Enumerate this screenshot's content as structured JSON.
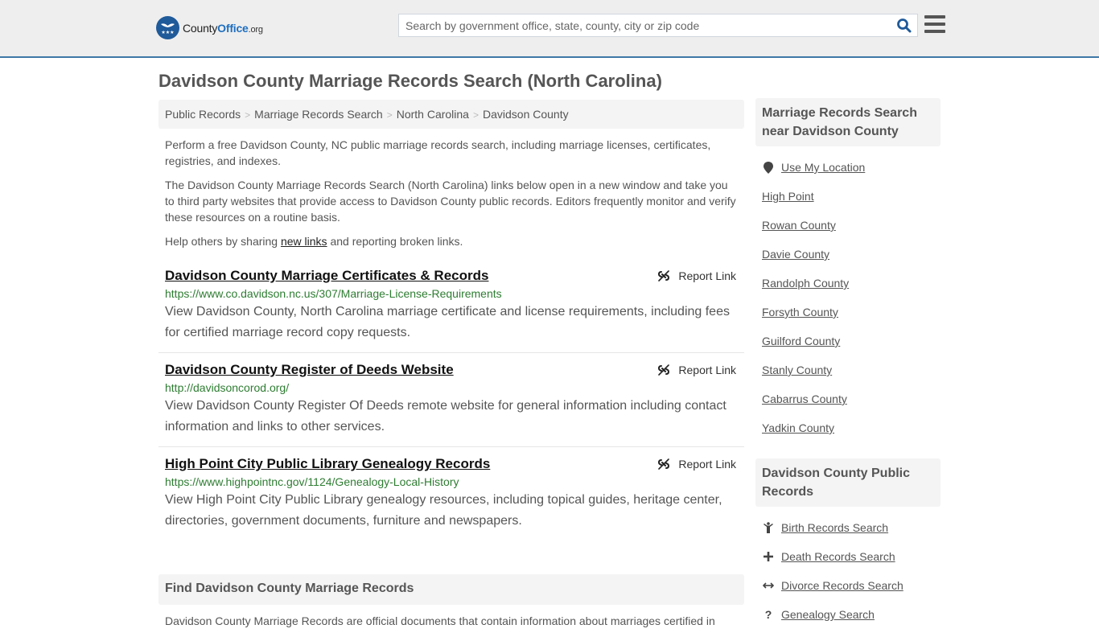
{
  "header": {
    "logo": {
      "prefix": "County",
      "brand": "Office",
      "suffix": ".org"
    },
    "search": {
      "placeholder": "Search by government office, state, county, city or zip code",
      "value": ""
    },
    "search_icon": "search-icon",
    "menu_icon": "hamburger-menu-icon"
  },
  "page": {
    "title": "Davidson County Marriage Records Search (North Carolina)"
  },
  "breadcrumb": [
    {
      "label": "Public Records"
    },
    {
      "label": "Marriage Records Search"
    },
    {
      "label": "North Carolina"
    },
    {
      "label": "Davidson County"
    }
  ],
  "intro": {
    "p1": "Perform a free Davidson County, NC public marriage records search, including marriage licenses, certificates, registries, and indexes.",
    "p2": "The Davidson County Marriage Records Search (North Carolina) links below open in a new window and take you to third party websites that provide access to Davidson County public records. Editors frequently monitor and verify these resources on a routine basis.",
    "p3_before": "Help others by sharing ",
    "p3_link": "new links",
    "p3_after": " and reporting broken links."
  },
  "results": [
    {
      "title": "Davidson County Marriage Certificates & Records",
      "url": "https://www.co.davidson.nc.us/307/Marriage-License-Requirements",
      "description": "View Davidson County, North Carolina marriage certificate and license requirements, including fees for certified marriage record copy requests.",
      "report_label": "Report Link"
    },
    {
      "title": "Davidson County Register of Deeds Website",
      "url": "http://davidsoncorod.org/",
      "description": "View Davidson County Register Of Deeds remote website for general information including contact information and links to other services.",
      "report_label": "Report Link"
    },
    {
      "title": "High Point City Public Library Genealogy Records",
      "url": "https://www.highpointnc.gov/1124/Genealogy-Local-History",
      "description": "View High Point City Public Library genealogy resources, including topical guides, heritage center, directories, government documents, furniture and newspapers.",
      "report_label": "Report Link"
    }
  ],
  "find_section": {
    "heading": "Find Davidson County Marriage Records",
    "text": "Davidson County Marriage Records are official documents that contain information about marriages certified in"
  },
  "sidebar": {
    "nearby": {
      "heading": "Marriage Records Search near Davidson County",
      "use_location": "Use My Location",
      "links": [
        "High Point",
        "Rowan County",
        "Davie County",
        "Randolph County",
        "Forsyth County",
        "Guilford County",
        "Stanly County",
        "Cabarrus County",
        "Yadkin County"
      ]
    },
    "public_records": {
      "heading": "Davidson County Public Records",
      "links": [
        {
          "label": "Birth Records Search",
          "icon": "child-icon"
        },
        {
          "label": "Death Records Search",
          "icon": "cross-icon"
        },
        {
          "label": "Divorce Records Search",
          "icon": "arrows-horizontal-icon"
        },
        {
          "label": "Genealogy Search",
          "icon": "question-icon"
        }
      ]
    }
  },
  "colors": {
    "accent_bar": "#3f78a6",
    "url_green": "#2e7d32",
    "search_icon": "#1f5a9a"
  }
}
